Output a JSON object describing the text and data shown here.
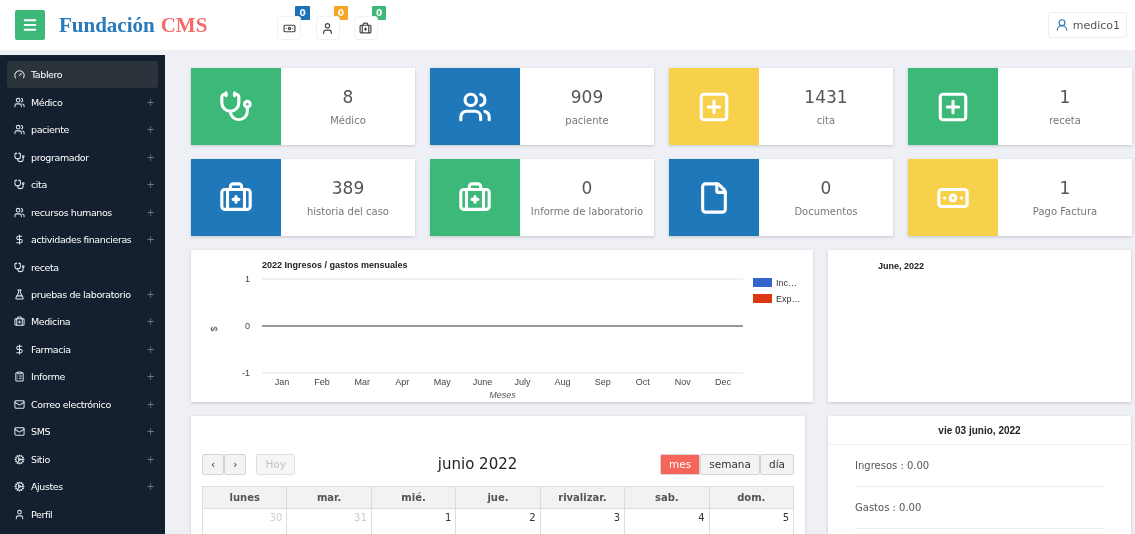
{
  "header": {
    "logo": {
      "part_1": "Fundación",
      "part_2": "CMS"
    },
    "notifications": [
      {
        "kind": "banknote",
        "count": "0",
        "color": "#1a72b8"
      },
      {
        "kind": "user",
        "count": "0",
        "color": "#f5a623"
      },
      {
        "kind": "briefcase",
        "count": "0",
        "color": "#3cb878"
      }
    ],
    "user": "medico1"
  },
  "sidebar": {
    "items": [
      {
        "label": "Tablero",
        "kind": "gauge",
        "selected": true
      },
      {
        "label": "Médico",
        "kind": "users",
        "expand": "+",
        "selected": false
      },
      {
        "label": "paciente",
        "kind": "users",
        "expand": "+",
        "selected": false
      },
      {
        "label": "programador",
        "kind": "stethoscope",
        "expand": "+",
        "selected": false
      },
      {
        "label": "cita",
        "kind": "stethoscope",
        "expand": "+",
        "selected": false
      },
      {
        "label": "recursos humanos",
        "kind": "users",
        "expand": "+",
        "selected": false
      },
      {
        "label": "actividades financieras",
        "kind": "dollar",
        "expand": "+",
        "selected": false
      },
      {
        "label": "receta",
        "kind": "stethoscope",
        "selected": false
      },
      {
        "label": "pruebas de laboratorio",
        "kind": "flask",
        "expand": "+",
        "selected": false
      },
      {
        "label": "Medicina",
        "kind": "briefcase",
        "expand": "+",
        "selected": false
      },
      {
        "label": "Farmacia",
        "kind": "dollar",
        "expand": "+",
        "selected": false
      },
      {
        "label": "Informe",
        "kind": "clipboard",
        "expand": "+",
        "selected": false
      },
      {
        "label": "Correo electrónico",
        "kind": "mail",
        "expand": "+",
        "selected": false
      },
      {
        "label": "SMS",
        "kind": "mail",
        "expand": "+",
        "selected": false
      },
      {
        "label": "Sitio",
        "kind": "cogs",
        "expand": "+",
        "selected": false
      },
      {
        "label": "Ajustes",
        "kind": "cogs",
        "expand": "+",
        "selected": false
      },
      {
        "label": "Perfil",
        "kind": "user",
        "selected": false
      }
    ]
  },
  "stats": [
    {
      "value": "8",
      "label": "Médico",
      "kind": "stethoscope",
      "color": "#3cb878"
    },
    {
      "value": "909",
      "label": "paciente",
      "kind": "users",
      "color": "#1f78b9"
    },
    {
      "value": "1431",
      "label": "cita",
      "kind": "plus",
      "color": "#f7d14c"
    },
    {
      "value": "1",
      "label": "receta",
      "kind": "plus",
      "color": "#3cb878"
    },
    {
      "value": "389",
      "label": "historia del caso",
      "kind": "briefcase",
      "color": "#1f78b9"
    },
    {
      "value": "0",
      "label": "Informe de laboratorio",
      "kind": "briefcase",
      "color": "#3cb878"
    },
    {
      "value": "0",
      "label": "Documentos",
      "kind": "file",
      "color": "#1f78b9"
    },
    {
      "value": "1",
      "label": "Pago Factura",
      "kind": "banknote",
      "color": "#f7d14c"
    }
  ],
  "income_chart": {
    "chart_data": {
      "type": "line",
      "title": "2022 Ingresos / gastos mensuales",
      "xlabel": "Meses",
      "ylabel": "$",
      "categories": [
        "Jan",
        "Feb",
        "Mar",
        "Apr",
        "May",
        "June",
        "July",
        "Aug",
        "Sep",
        "Oct",
        "Nov",
        "Dec"
      ],
      "series": [
        {
          "name": "Inc…",
          "color": "#3366cc",
          "values": [
            null,
            null,
            null,
            null,
            null,
            null,
            null,
            null,
            null,
            null,
            null,
            null
          ]
        },
        {
          "name": "Exp…",
          "color": "#dc3912",
          "values": [
            null,
            null,
            null,
            null,
            null,
            null,
            null,
            null,
            null,
            null,
            null,
            null
          ]
        }
      ],
      "ylim": [
        -1,
        1
      ],
      "yticks": [
        -1,
        0,
        1
      ]
    }
  },
  "month_panel": {
    "title": "June, 2022"
  },
  "calendar": {
    "prev": "‹",
    "next": "›",
    "today": {
      "label": "Hoy",
      "disabled": true
    },
    "title": "junio 2022",
    "views": [
      {
        "label": "mes",
        "selected": true
      },
      {
        "label": "semana",
        "selected": false
      },
      {
        "label": "día",
        "selected": false
      }
    ],
    "weekdays": [
      "lunes",
      "mar.",
      "mié.",
      "jue.",
      "rivalizar.",
      "sab.",
      "dom."
    ],
    "days": [
      {
        "label": "30",
        "other_month": true
      },
      {
        "label": "31",
        "other_month": true
      },
      {
        "label": "1",
        "other_month": false
      },
      {
        "label": "2",
        "other_month": false
      },
      {
        "label": "3",
        "other_month": false
      },
      {
        "label": "4",
        "other_month": false
      },
      {
        "label": "5",
        "other_month": false
      }
    ]
  },
  "day_summary": {
    "title": "vie 03 junio, 2022",
    "rows": [
      "Ingresos : 0.00",
      "Gastos : 0.00"
    ]
  }
}
